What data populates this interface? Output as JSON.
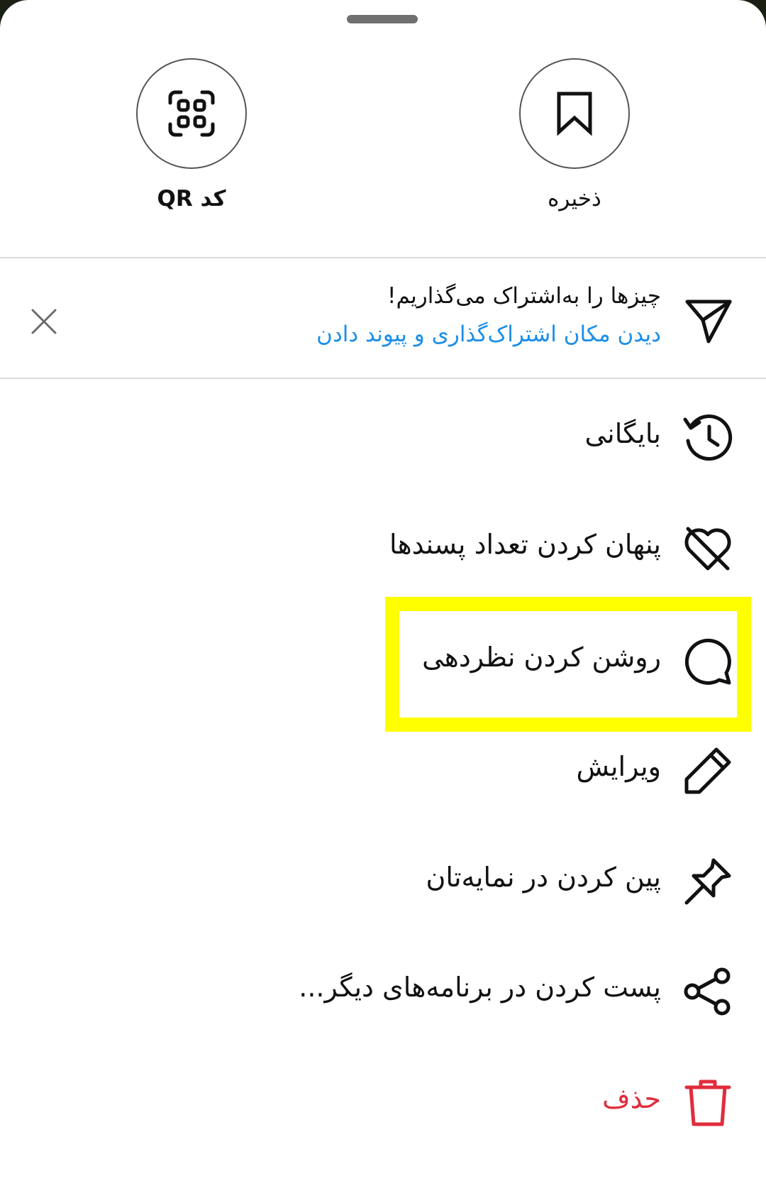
{
  "top_actions": {
    "save_label": "ذخیره",
    "qr_label": "کد QR"
  },
  "notice": {
    "title": "چیزها را به‌اشتراک می‌گذاریم!",
    "link": "دیدن مکان اشتراک‌گذاری و پیوند دادن"
  },
  "menu": {
    "items": [
      {
        "label": "بایگانی",
        "icon": "archive-history-icon"
      },
      {
        "label": "پنهان کردن تعداد پسندها",
        "icon": "heart-off-icon"
      },
      {
        "label": "روشن کردن نظردهی",
        "icon": "comment-icon"
      },
      {
        "label": "ویرایش",
        "icon": "pencil-icon"
      },
      {
        "label": "پین کردن در نمایه‌تان",
        "icon": "pin-icon"
      },
      {
        "label": "پست کردن در برنامه‌های دیگر...",
        "icon": "share-icon"
      },
      {
        "label": "حذف",
        "icon": "trash-icon"
      }
    ]
  },
  "colors": {
    "link": "#1a8ee8",
    "danger": "#e02d3c",
    "highlight": "#ffff00"
  }
}
